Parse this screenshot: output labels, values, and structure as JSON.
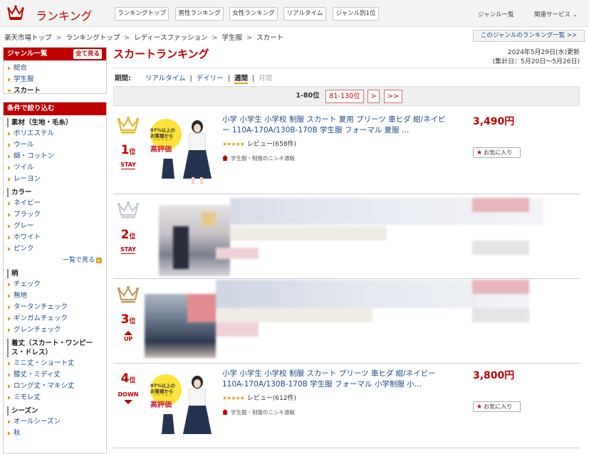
{
  "header": {
    "logo_text": "ランキング",
    "tabs": [
      "ランキングトップ",
      "男性ランキング",
      "女性ランキング",
      "リアルタイム",
      "ジャンル別1位"
    ],
    "links": {
      "genre_list": "ジャンル一覧",
      "related": "関連サービス"
    }
  },
  "breadcrumb": [
    "楽天市場トップ",
    "ランキングトップ",
    "レディースファッション",
    "学生服",
    "スカート"
  ],
  "genre_ranking_link": "このジャンルのランキング一覧 >>",
  "sidebar": {
    "genre": {
      "title": "ジャンル一覧",
      "show_all": "全て見る",
      "items": [
        "総合",
        "学生服",
        "スカート"
      ]
    },
    "filter": {
      "title": "条件で絞り込む",
      "groups": [
        {
          "label": "素材（生地・毛糸）",
          "items": [
            "ポリエステル",
            "ウール",
            "綿・コットン",
            "ツイル",
            "レーヨン"
          ]
        },
        {
          "label": "カラー",
          "items": [
            "ネイビー",
            "ブラック",
            "グレー",
            "ホワイト",
            "ピンク"
          ],
          "more": "一覧で見る"
        },
        {
          "label": "柄",
          "items": [
            "チェック",
            "無地",
            "タータンチェック",
            "ギンガムチェック",
            "グレンチェック"
          ]
        },
        {
          "label": "着丈（スカート・ワンピース・ドレス）",
          "items": [
            "ミニ丈・ショート丈",
            "膝丈・ミディ丈",
            "ロング丈・マキシ丈",
            "ミモレ丈"
          ]
        },
        {
          "label": "シーズン",
          "items": [
            "オールシーズン",
            "秋"
          ]
        }
      ]
    }
  },
  "main": {
    "title": "スカートランキング",
    "date_line1": "2024年5月29日(水)更新",
    "date_line2": "(集計日：5月20日〜5月26日)",
    "period": {
      "label": "期間:",
      "options": [
        "リアルタイム",
        "デイリー",
        "週間",
        "月間"
      ],
      "selected": "週間",
      "disabled": "月間"
    },
    "pager": {
      "current": "1-80位",
      "next_range": "81-130位",
      "next": ">",
      "last": ">>"
    }
  },
  "items": [
    {
      "rank_num": "1",
      "rank_suffix": "位",
      "status": "STAY",
      "title": "小学 小学生 小学校 制服 スカート 夏用 プリーツ 車ヒダ 紺/ネイビー 110A-170A/130B-170B 学生服 フォーマル 夏服 …",
      "stars": "★★★★★",
      "review": "レビュー(658件)",
      "shop": "学生服・制服のニシキ通販",
      "price": "3,490円",
      "fav": "お気に入り",
      "badge_line1": "97%以上の",
      "badge_line2": "お客様から",
      "badge_line3": "高評価"
    },
    {
      "rank_num": "2",
      "rank_suffix": "位",
      "status": "STAY"
    },
    {
      "rank_num": "3",
      "rank_suffix": "位",
      "status": "UP"
    },
    {
      "rank_num": "4",
      "rank_suffix": "位",
      "status": "DOWN",
      "title": "小学 小学生 小学校 制服 スカート プリーツ 車ヒダ 紺/ネイビー 110A-170A/130B-170B 学生服 フォーマル 小学制服 小…",
      "stars": "★★★★★",
      "review": "レビュー(612件)",
      "shop": "学生服・制服のニシキ通販",
      "price": "3,800円",
      "fav": "お気に入り",
      "badge_line1": "97%以上の",
      "badge_line2": "お客様から",
      "badge_line3": "高評価"
    }
  ],
  "colors": {
    "brand": "#bf0000",
    "link": "#1a4a8a",
    "accent": "#e0a020"
  }
}
